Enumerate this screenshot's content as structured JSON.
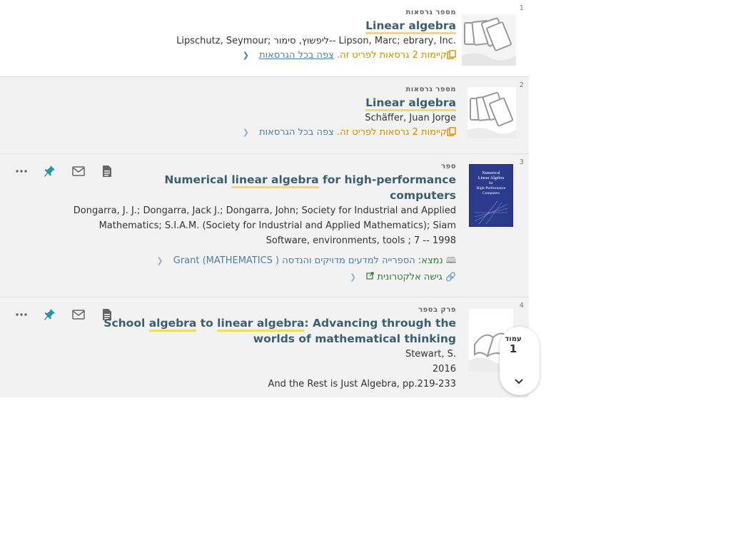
{
  "results": [
    {
      "number": "1",
      "type": "מספר גרסאות",
      "title_highlight": "Linear algebra",
      "authors": "Lipschutz, Seymour; ליפשוץ, סימור-- Lipson, Marc; ebrary, Inc.",
      "versions_text": "קיימות 2 גרסאות לפריט זה.",
      "versions_link": "צפה בכל הגרסאות",
      "thumbnail_icon": "multiple-versions-icon"
    },
    {
      "number": "2",
      "type": "מספר גרסאות",
      "title_highlight": "Linear algebra",
      "authors": "Schäffer, Juan Jorge",
      "versions_text": "קיימות 2 גרסאות לפריט זה.",
      "versions_link": "צפה בכל הגרסאות",
      "thumbnail_icon": "multiple-versions-icon"
    },
    {
      "number": "3",
      "type": "ספר",
      "title_pre": "Numerical ",
      "title_highlight": "linear algebra",
      "title_line1_post": " for high-performance",
      "title_line2": "computers",
      "authors_line1": "Dongarra, J. J.; Dongarra, Jack J.; Dongarra, John; Society for Industrial and Applied",
      "authors_line2": "Mathematics; S.I.A.M. (Society for Industrial and Applied Mathematics); Siam",
      "pub_line": "Software, environments, tools ; 7 -- 1998",
      "location_label": "נמצא:",
      "location_value": "הספרייה למדעים מדויקים והנדסה  Grant  (MATHEMATICS )",
      "online_access": "גישה אלקטרונית",
      "cover_title": "Numerical Linear Algebra for High-Performance Computers"
    },
    {
      "number": "4",
      "type": "פרק בספר",
      "title_w1": "School ",
      "title_hl1": "algebra",
      "title_w2": " to ",
      "title_hl2": "linear algebra",
      "title_post": ": Advancing through the",
      "title_line2": "worlds of mathematical thinking",
      "author": "Stewart, S.",
      "year": "2016",
      "source": "And the Rest is Just Algebra, pp.219-233",
      "thumbnail_icon": "open-book-icon"
    }
  ],
  "actions": [
    "more-icon",
    "pin-icon",
    "email-icon",
    "citation-icon"
  ],
  "pagination": {
    "label": "עמוד",
    "page": "1"
  },
  "colors": {
    "highlight": "#f7dc55",
    "title": "#3a5f6e",
    "accent": "#4aa3b5",
    "orange": "#d98b00",
    "link": "#4a7fa8"
  }
}
